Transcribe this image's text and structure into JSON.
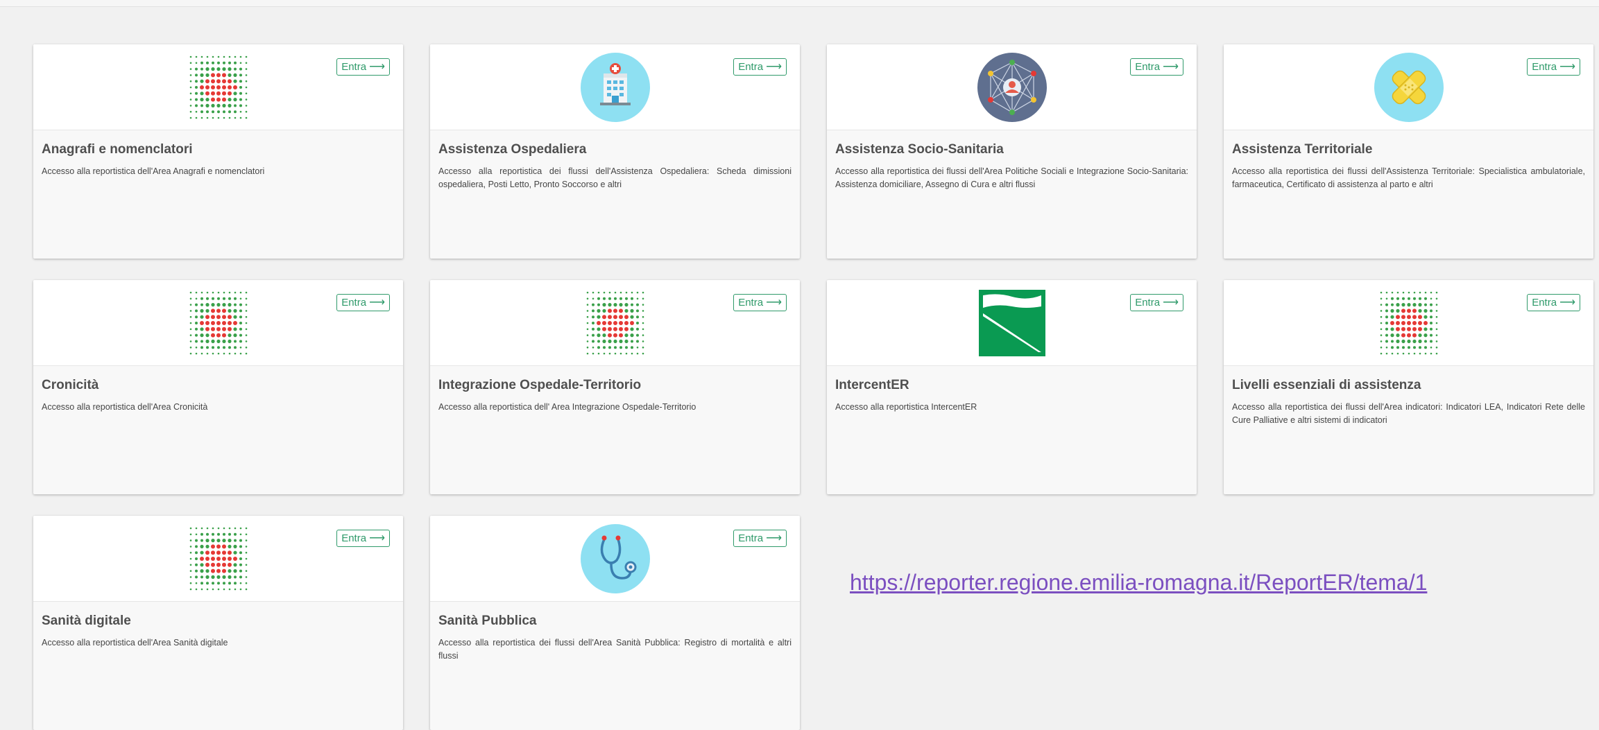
{
  "entra_label": "Entra",
  "colors": {
    "accent": "#2f9a6a",
    "dot_green": "#3aa04a",
    "dot_red": "#e53935",
    "link": "#7b4fc0"
  },
  "cards": [
    {
      "title": "Anagrafi e nomenclatori",
      "desc": "Accesso alla reportistica dell'Area Anagrafi e nomenclatori",
      "icon": "dot-grid-icon"
    },
    {
      "title": "Assistenza Ospedaliera",
      "desc": "Accesso alla reportistica dei flussi dell'Assistenza Ospedaliera: Scheda dimissioni ospedaliera, Posti Letto, Pronto Soccorso e altri",
      "icon": "hospital-icon"
    },
    {
      "title": "Assistenza Socio-Sanitaria",
      "desc": "Accesso alla reportistica dei flussi dell'Area Politiche Sociali e Integrazione Socio-Sanitaria: Assistenza domiciliare, Assegno di Cura e altri flussi",
      "icon": "social-network-icon"
    },
    {
      "title": "Assistenza Territoriale",
      "desc": "Accesso alla reportistica dei flussi dell'Assistenza Territoriale: Specialistica ambulatoriale, farmaceutica, Certificato di assistenza al parto e altri",
      "icon": "bandage-icon"
    },
    {
      "title": "Cronicità",
      "desc": "Accesso alla reportistica dell'Area Cronicità",
      "icon": "dot-grid-icon"
    },
    {
      "title": "Integrazione Ospedale-Territorio",
      "desc": "Accesso alla reportistica dell' Area Integrazione Ospedale-Territorio",
      "icon": "dot-grid-icon"
    },
    {
      "title": "IntercentER",
      "desc": "Accesso alla reportistica IntercentER",
      "icon": "emilia-romagna-flag-icon"
    },
    {
      "title": "Livelli essenziali di assistenza",
      "desc": "Accesso alla reportistica dei flussi dell'Area indicatori: Indicatori LEA, Indicatori Rete delle Cure Palliative e altri sistemi di indicatori",
      "icon": "dot-grid-icon"
    },
    {
      "title": "Sanità digitale",
      "desc": "Accesso alla reportistica dell'Area Sanità digitale",
      "icon": "dot-grid-icon"
    },
    {
      "title": "Sanità Pubblica",
      "desc": "Accesso alla reportistica dei flussi dell'Area Sanità Pubblica: Registro di mortalità e altri flussi",
      "icon": "stethoscope-icon"
    }
  ],
  "url": "https://reporter.regione.emilia-romagna.it/ReportER/tema/1"
}
